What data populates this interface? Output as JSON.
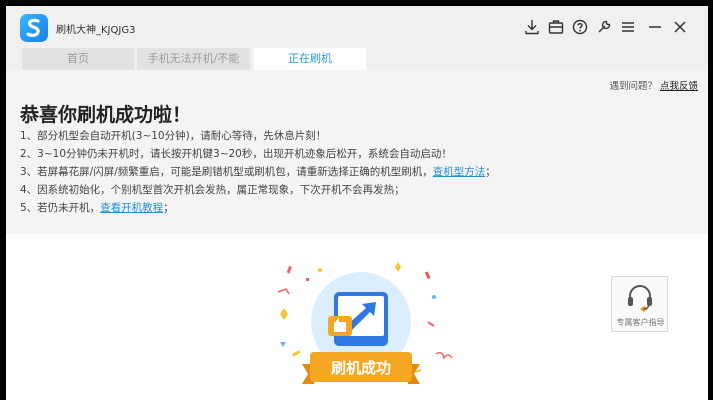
{
  "window": {
    "title": "刷机大神_KJQJG3",
    "controls": [
      "download-icon",
      "toolbox-icon",
      "help-icon",
      "wrench-icon",
      "menu-icon",
      "minimize-icon",
      "close-icon"
    ]
  },
  "tabs": [
    {
      "label": "首页",
      "active": false
    },
    {
      "label": "手机无法开机/不能",
      "active": false
    },
    {
      "label": "正在刷机",
      "active": true
    }
  ],
  "help": {
    "question": "遇到问题？",
    "feedback_link": "点我反馈"
  },
  "success": {
    "headline": "恭喜你刷机成功啦！",
    "tips": [
      {
        "text": "1、部分机型会自动开机(3~10分钟)，请耐心等待，先休息片刻！"
      },
      {
        "text": "2、3~10分钟仍未开机时，请长按开机键3~20秒，出现开机迹象后松开，系统会自动启动！"
      },
      {
        "text": "3、若屏幕花屏/闪屏/频繁重启，可能是刷错机型或刷机包，请重新选择正确的机型刷机，",
        "link": "查机型方法",
        "suffix": "；"
      },
      {
        "text": "4、因系统初始化，个别机型首次开机会发热，属正常现象，下次开机不会再发热；"
      },
      {
        "text": "5、若仍未开机，",
        "link": "查看开机教程",
        "suffix": "；"
      }
    ],
    "badge_text": "刷机成功"
  },
  "support": {
    "label": "专属客户指导"
  },
  "colors": {
    "accent": "#2a9bd8",
    "banner": "#f5a623",
    "link": "#2a8fd0"
  }
}
